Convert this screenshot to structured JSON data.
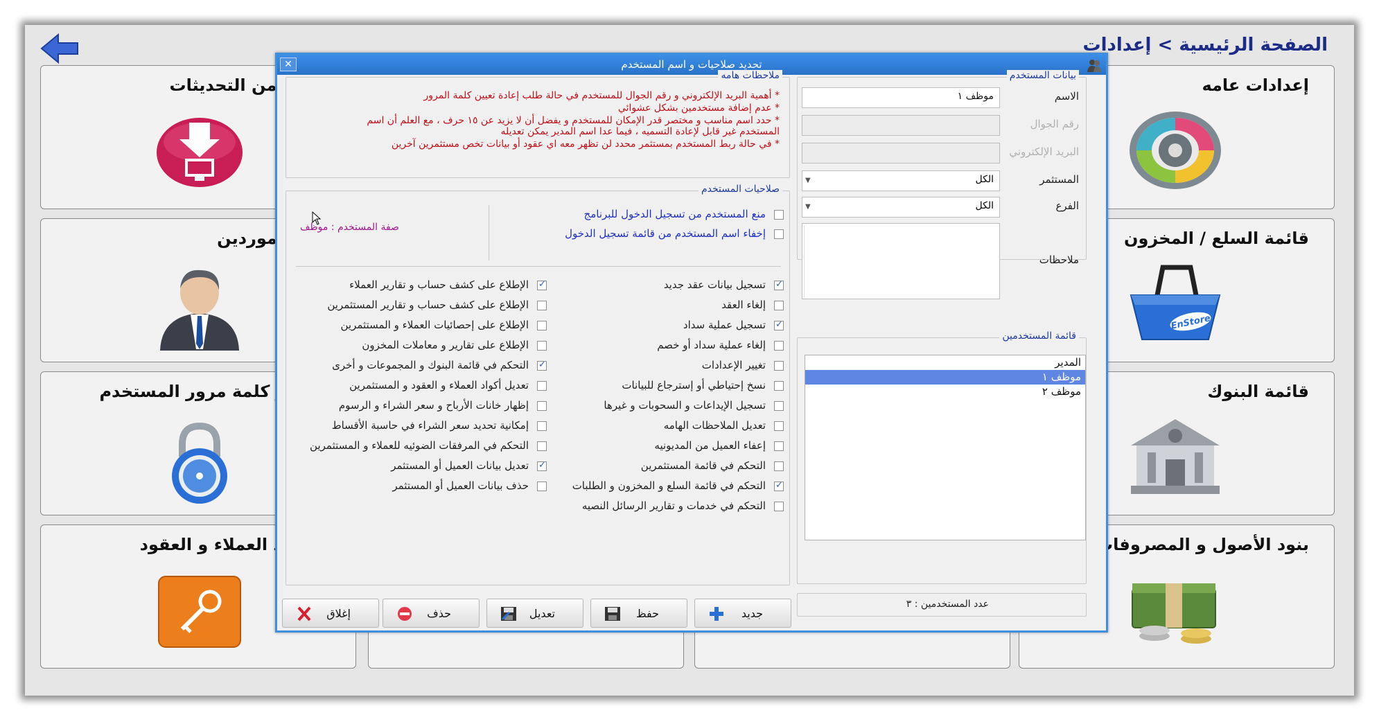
{
  "breadcrumb": "الصفحة الرئيسية > إعدادات",
  "tiles": {
    "general": "إعدادات عامه",
    "updates": "التحقق من التحديثات",
    "goods": "قائمة السلع / المخزون",
    "suppliers": "قائمة الموردين",
    "banks": "قائمة البنوك",
    "user_data": "بيانات و كلمة مرور المستخدم",
    "assets": "بنود الأصول و المصروفات و ال",
    "codes": "يل أكواد العملاء و العقود"
  },
  "dialog": {
    "title": "تحديد صلاحيات و اسم المستخدم",
    "user_data": {
      "caption": "بيانات المستخدم",
      "name_label": "الاسم",
      "name_value": "موظف ١",
      "mobile_label": "رقم الجوال",
      "email_label": "البريد الإلكتروني",
      "investor_label": "المستثمر",
      "investor_value": "الكل",
      "branch_label": "الفرع",
      "branch_value": "الكل",
      "notes_label": "ملاحظات"
    },
    "notes": {
      "caption": "ملاحظات هامه",
      "lines": [
        "* أهمية البريد الإلكتروني و رقم الجوال للمستخدم في حالة طلب إعادة تعيين كلمة المرور",
        "* عدم إضافة مستخدمين بشكل عشوائي",
        "* حدد اسم مناسب و مختصر قدر الإمكان للمستخدم و يفضل أن لا يزيد عن ١٥ حرف ، مع العلم أن اسم",
        "المستخدم غير قابل لإعادة التسميه ، فيما عدا اسم المدير يمكن تعديله",
        "* في حالة ربط المستخدم بمستثمر محدد لن تظهر معه اي عقود أو بيانات تخص مستثمرين آخرين"
      ]
    },
    "perms": {
      "caption": "صلاحيات المستخدم",
      "top": [
        {
          "label": "منع المستخدم من تسجيل الدخول للبرنامج",
          "checked": false
        },
        {
          "label": "إخفاء اسم المستخدم من قائمة تسجيل الدخول",
          "checked": false
        }
      ],
      "role_text": "صفة المستخدم : موظف",
      "right": [
        {
          "label": "تسجيل بيانات عقد جديد",
          "checked": true
        },
        {
          "label": "إلغاء العقد",
          "checked": false
        },
        {
          "label": "تسجيل عملية سداد",
          "checked": true
        },
        {
          "label": "إلغاء عملية سداد أو خصم",
          "checked": false
        },
        {
          "label": "تغيير الإعدادات",
          "checked": false
        },
        {
          "label": "نسخ إحتياطي أو إسترجاع للبيانات",
          "checked": false
        },
        {
          "label": "تسجيل الإيداعات و السحوبات و غيرها",
          "checked": false
        },
        {
          "label": "تعديل الملاحظات الهامه",
          "checked": false
        },
        {
          "label": "إعفاء العميل من المديونيه",
          "checked": false
        },
        {
          "label": "التحكم في قائمة المستثمرين",
          "checked": false
        },
        {
          "label": "التحكم في قائمة السلع و المخزون و الطلبات",
          "checked": true
        },
        {
          "label": "التحكم في خدمات و تقارير الرسائل النصيه",
          "checked": false
        }
      ],
      "left": [
        {
          "label": "الإطلاع على كشف حساب و تقارير العملاء",
          "checked": true
        },
        {
          "label": "الإطلاع على كشف حساب و تقارير المستثمرين",
          "checked": false
        },
        {
          "label": "الإطلاع على إحصائيات العملاء و المستثمرين",
          "checked": false
        },
        {
          "label": "الإطلاع على تقارير و معاملات المخزون",
          "checked": false
        },
        {
          "label": "التحكم في قائمة البنوك و المجموعات و أخرى",
          "checked": true
        },
        {
          "label": "تعديل أكواد العملاء و العقود و المستثمرين",
          "checked": false
        },
        {
          "label": "إظهار خانات الأرباح و سعر الشراء و الرسوم",
          "checked": false
        },
        {
          "label": "إمكانية تحديد سعر الشراء في حاسبة الأقساط",
          "checked": false
        },
        {
          "label": "التحكم في المرفقات الضوئيه للعملاء و المستثمرين",
          "checked": false
        },
        {
          "label": "تعديل بيانات العميل أو المستثمر",
          "checked": true
        },
        {
          "label": "حذف بيانات العميل أو المستثمر",
          "checked": false
        }
      ]
    },
    "users": {
      "caption": "قائمة المستخدمين",
      "items": [
        "المدير",
        "موظف ١",
        "موظف ٢"
      ],
      "selected_index": 1,
      "count_text": "عدد المستخدمين : ٣"
    },
    "buttons": {
      "new": "جديد",
      "save": "حفظ",
      "edit": "تعديل",
      "delete": "حذف",
      "close": "إغلاق"
    }
  }
}
